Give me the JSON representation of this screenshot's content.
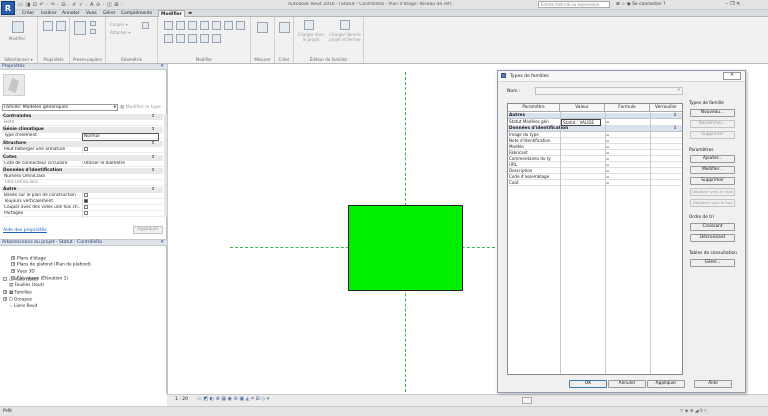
{
  "app": {
    "logo": "R",
    "quick_access": "▭ ◨ ⊡ ↶ · ↷ · ⊟ · ✐ ✓ · A ⊙ · ◫ ⊞ ·",
    "window_title": "Autodesk Revit 2016 - [Statut - ContrôleRa - Plan d'étage: Niveau de réf]",
    "search_placeholder": "Entrez mot-clé ou expression",
    "connect_label": "Se connecter",
    "help_label": "?"
  },
  "tabs": [
    "Créer",
    "Insérer",
    "Annoter",
    "Vues",
    "Gérer",
    "Compléments",
    "Modifier"
  ],
  "active_tab": "Modifier",
  "ribbon": {
    "groups": [
      {
        "label": "Sélectionner ▾",
        "items": [
          "Modifier"
        ]
      },
      {
        "label": "Propriétés",
        "items": []
      },
      {
        "label": "Presse-papiers",
        "items": []
      },
      {
        "label": "Géométrie",
        "items": [
          "Couper ▾",
          "Attacher ▾"
        ]
      },
      {
        "label": "Modifier",
        "items": []
      },
      {
        "label": "Mesurer",
        "items": []
      },
      {
        "label": "Créer",
        "items": []
      },
      {
        "label": "Éditeur de familles",
        "items": [
          "Charger dans le projet",
          "Charger dans le projet et fermer"
        ]
      }
    ]
  },
  "properties": {
    "title": "Propriétés",
    "family_type": "Famille: Modèles génériques",
    "edit_type": "Modifier le type",
    "sections": [
      {
        "name": "Contraintes",
        "rows": [
          {
            "k": "Hôte",
            "v": ""
          }
        ]
      },
      {
        "name": "Génie climatique",
        "rows": [
          {
            "k": "Type d'élément",
            "v": "Normal"
          }
        ]
      },
      {
        "name": "Structure",
        "rows": [
          {
            "k": "Peut héberger une armature",
            "v": "cb0"
          }
        ]
      },
      {
        "name": "Cotes",
        "rows": [
          {
            "k": "Cote de connecteur circulaire",
            "v": "Utiliser le diamètre"
          }
        ]
      },
      {
        "name": "Données d'identification",
        "rows": [
          {
            "k": "Numéro OmniClass",
            "v": ""
          },
          {
            "k": "Titre OmniClass",
            "v": ""
          }
        ]
      },
      {
        "name": "Autre",
        "rows": [
          {
            "k": "Basée sur le plan de construction",
            "v": "cb0"
          },
          {
            "k": "Toujours verticalement",
            "v": "cb1"
          },
          {
            "k": "Couper avec des vides une fois ch...",
            "v": "cb0"
          },
          {
            "k": "Partagée",
            "v": "cb0"
          }
        ]
      }
    ],
    "help_link": "Aide des propriétés",
    "apply": "Appliquer"
  },
  "browser": {
    "title": "Arborescence du projet - Statut - ContrôleRa",
    "items": [
      {
        "t": "Vues (tout)",
        "lvl": 0,
        "pm": "-"
      },
      {
        "t": "Plans d'étage",
        "lvl": 1,
        "pm": "+"
      },
      {
        "t": "Plans de plafond (Plan de plafond)",
        "lvl": 1,
        "pm": "+"
      },
      {
        "t": "Vues 3D",
        "lvl": 1,
        "pm": "+"
      },
      {
        "t": "Élévations (Élévation 1)",
        "lvl": 1,
        "pm": "+"
      },
      {
        "t": "Feuilles (tout)",
        "lvl": 0,
        "pm": ""
      },
      {
        "t": "Familles",
        "lvl": 0,
        "pm": "+"
      },
      {
        "t": "Groupes",
        "lvl": 0,
        "pm": "+"
      },
      {
        "t": "Liens Revit",
        "lvl": 0,
        "pm": ""
      }
    ]
  },
  "view": {
    "scale": "1 : 20",
    "element_color": "#00ee00",
    "ref_line_color": "#3ab54a"
  },
  "status": {
    "left": "Prêt",
    "right": "◢ 0 ▿"
  },
  "dialog": {
    "title": "Types de familles",
    "name_label": "Nom :",
    "name_value": "",
    "columns": [
      "Paramètre",
      "Valeur",
      "Formule",
      "Verrouiller"
    ],
    "sections": [
      {
        "name": "Autres",
        "rows": [
          {
            "p": "Statut Modèles gén",
            "v": "Statut : VALIDE",
            "f": "="
          }
        ]
      },
      {
        "name": "Données d'identification",
        "rows": [
          {
            "p": "Image du type",
            "v": "",
            "f": "="
          },
          {
            "p": "Note d'identification",
            "v": "",
            "f": "="
          },
          {
            "p": "Modèle",
            "v": "",
            "f": "="
          },
          {
            "p": "Fabricant",
            "v": "",
            "f": "="
          },
          {
            "p": "Commentaires du ty",
            "v": "",
            "f": "="
          },
          {
            "p": "URL",
            "v": "",
            "f": "="
          },
          {
            "p": "Description",
            "v": "",
            "f": "="
          },
          {
            "p": "Code d'assemblage",
            "v": "",
            "f": "="
          },
          {
            "p": "Coût",
            "v": "",
            "f": "="
          }
        ]
      }
    ],
    "family_types": {
      "title": "Types de famille",
      "new": "Nouveau...",
      "rename": "Renommer...",
      "delete": "Supprimer"
    },
    "parameters": {
      "title": "Paramètres",
      "add": "Ajouter...",
      "modify": "Modifier...",
      "delete": "Supprimer",
      "up": "Déplacer vers le haut",
      "down": "Déplacer vers le bas"
    },
    "sort": {
      "title": "Ordre de tri",
      "asc": "Croissant",
      "desc": "Décroissant"
    },
    "lookup": {
      "title": "Tables de consultation",
      "manage": "Gérer..."
    },
    "footer": {
      "ok": "OK",
      "cancel": "Annuler",
      "apply": "Appliquer",
      "help": "Aide"
    }
  }
}
